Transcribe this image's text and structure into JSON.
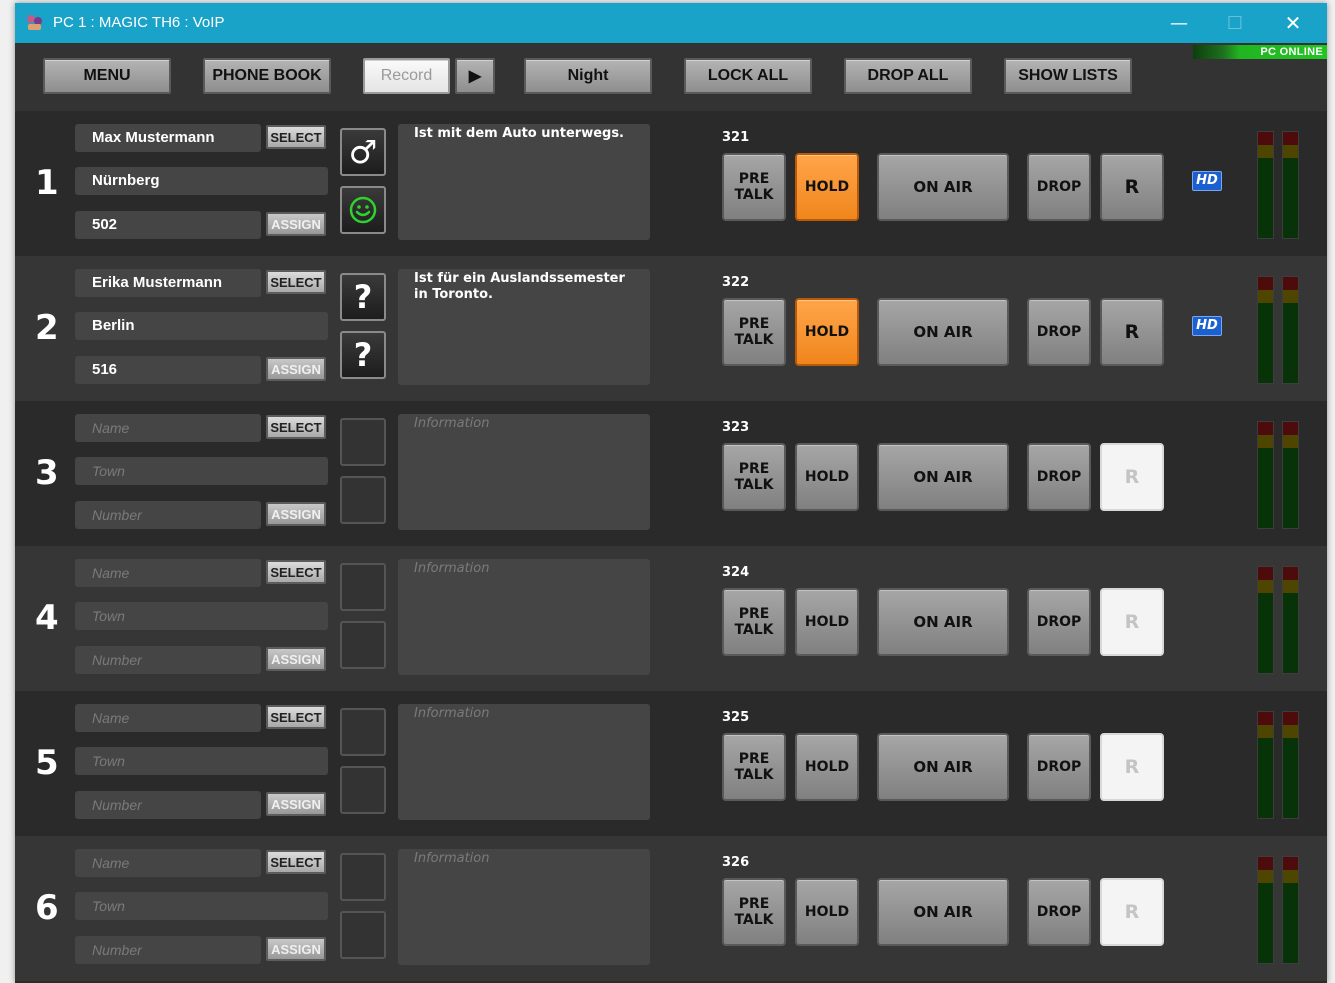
{
  "window": {
    "title": "PC 1 : MAGIC TH6 : VoIP",
    "minimize_glyph": "—",
    "maximize_glyph": "☐",
    "close_glyph": "✕"
  },
  "toolbar": {
    "menu": "MENU",
    "phone_book": "PHONE BOOK",
    "record": "Record",
    "play_glyph": "▶",
    "night": "Night",
    "lock_all": "LOCK ALL",
    "drop_all": "DROP ALL",
    "show_lists": "SHOW LISTS",
    "status": "PC ONLINE"
  },
  "colors": {
    "titlebar": "#1aa3c8",
    "hold_active": "#f0861c",
    "hd_badge": "#1b5fd0",
    "online": "#22c422",
    "smiley": "#2fd12f"
  },
  "placeholders": {
    "name": "Name",
    "town": "Town",
    "number": "Number",
    "information": "Information"
  },
  "labels": {
    "select": "SELECT",
    "assign": "ASSIGN",
    "pre_talk_1": "PRE",
    "pre_talk_2": "TALK",
    "hold": "HOLD",
    "on_air": "ON AIR",
    "drop": "DROP",
    "r": "R",
    "hd": "HD"
  },
  "lines": [
    {
      "number": "1",
      "name": "Max Mustermann",
      "town": "Nürnberg",
      "phone": "502",
      "info": "Ist mit dem Auto unterwegs.",
      "ext": "321",
      "hold_active": true,
      "hd": true,
      "r_active": true,
      "icon_top": "male-icon",
      "icon_bottom": "smiley-icon",
      "icon_top_glyph": "♂",
      "icon_bottom_glyph": "☺"
    },
    {
      "number": "2",
      "name": "Erika Mustermann",
      "town": "Berlin",
      "phone": "516",
      "info": "Ist für ein Auslandssemester in Toronto.",
      "ext": "322",
      "hold_active": true,
      "hd": true,
      "r_active": true,
      "icon_top": "question-icon",
      "icon_bottom": "question-icon",
      "icon_top_glyph": "?",
      "icon_bottom_glyph": "?"
    },
    {
      "number": "3",
      "name": "",
      "town": "",
      "phone": "",
      "info": "",
      "ext": "323",
      "hold_active": false,
      "hd": false,
      "r_active": false
    },
    {
      "number": "4",
      "name": "",
      "town": "",
      "phone": "",
      "info": "",
      "ext": "324",
      "hold_active": false,
      "hd": false,
      "r_active": false
    },
    {
      "number": "5",
      "name": "",
      "town": "",
      "phone": "",
      "info": "",
      "ext": "325",
      "hold_active": false,
      "hd": false,
      "r_active": false
    },
    {
      "number": "6",
      "name": "",
      "town": "",
      "phone": "",
      "info": "",
      "ext": "326",
      "hold_active": false,
      "hd": false,
      "r_active": false
    }
  ]
}
